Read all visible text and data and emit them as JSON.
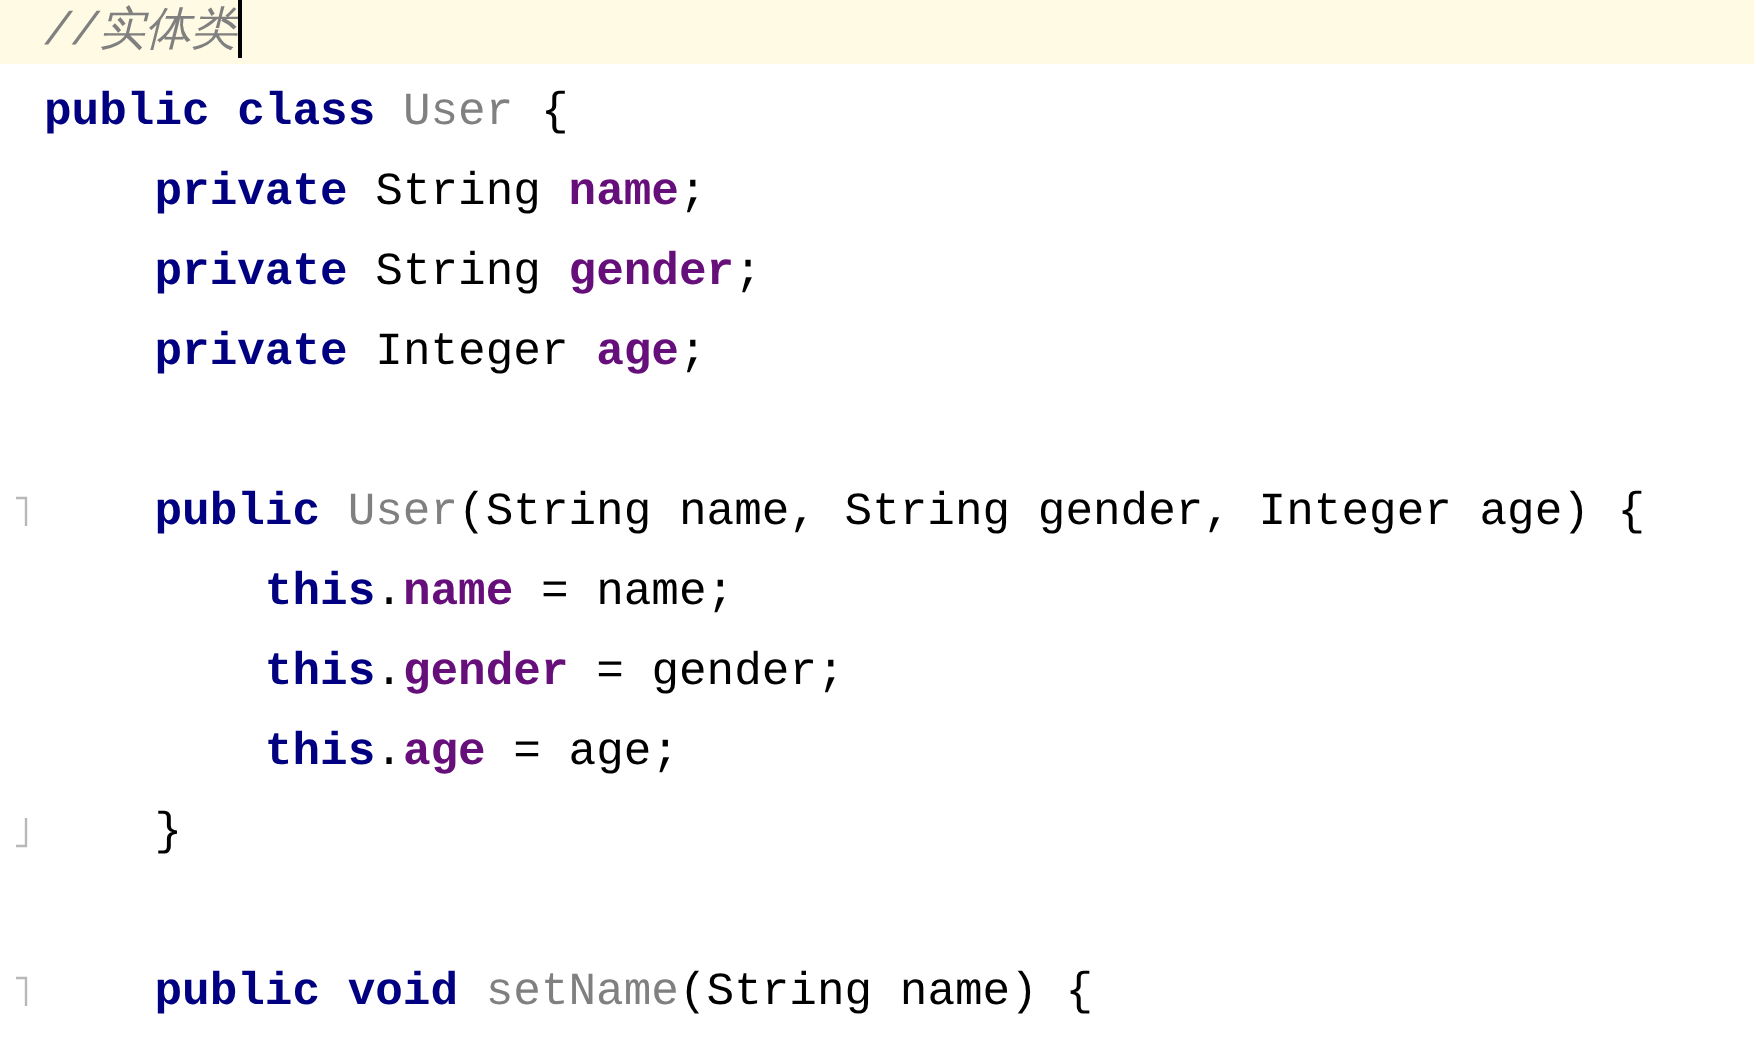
{
  "editor": {
    "lines": [
      {
        "current": true,
        "fold_start": false,
        "fold_end": false,
        "tokens": [
          {
            "kind": "comment",
            "text": "//实体类"
          }
        ]
      },
      {
        "current": false,
        "fold_start": false,
        "fold_end": false,
        "tokens": [
          {
            "kind": "keyword",
            "text": "public class "
          },
          {
            "kind": "unused",
            "text": "User"
          },
          {
            "kind": "plain",
            "text": " {"
          }
        ]
      },
      {
        "current": false,
        "fold_start": false,
        "fold_end": false,
        "tokens": [
          {
            "kind": "keyword",
            "text": "    private "
          },
          {
            "kind": "plain",
            "text": "String "
          },
          {
            "kind": "field",
            "text": "name"
          },
          {
            "kind": "plain",
            "text": ";"
          }
        ]
      },
      {
        "current": false,
        "fold_start": false,
        "fold_end": false,
        "tokens": [
          {
            "kind": "keyword",
            "text": "    private "
          },
          {
            "kind": "plain",
            "text": "String "
          },
          {
            "kind": "field",
            "text": "gender"
          },
          {
            "kind": "plain",
            "text": ";"
          }
        ]
      },
      {
        "current": false,
        "fold_start": false,
        "fold_end": false,
        "tokens": [
          {
            "kind": "keyword",
            "text": "    private "
          },
          {
            "kind": "plain",
            "text": "Integer "
          },
          {
            "kind": "field",
            "text": "age"
          },
          {
            "kind": "plain",
            "text": ";"
          }
        ]
      },
      {
        "current": false,
        "fold_start": false,
        "fold_end": false
      },
      {
        "current": false,
        "fold_start": true,
        "fold_end": false,
        "tokens": [
          {
            "kind": "keyword",
            "text": "    public "
          },
          {
            "kind": "unused",
            "text": "User"
          },
          {
            "kind": "plain",
            "text": "(String name, String gender, Integer age) {"
          }
        ]
      },
      {
        "current": false,
        "fold_start": false,
        "fold_end": false,
        "tokens": [
          {
            "kind": "keyword",
            "text": "        this"
          },
          {
            "kind": "plain",
            "text": "."
          },
          {
            "kind": "field",
            "text": "name"
          },
          {
            "kind": "plain",
            "text": " = name;"
          }
        ]
      },
      {
        "current": false,
        "fold_start": false,
        "fold_end": false,
        "tokens": [
          {
            "kind": "keyword",
            "text": "        this"
          },
          {
            "kind": "plain",
            "text": "."
          },
          {
            "kind": "field",
            "text": "gender"
          },
          {
            "kind": "plain",
            "text": " = gender;"
          }
        ]
      },
      {
        "current": false,
        "fold_start": false,
        "fold_end": false,
        "tokens": [
          {
            "kind": "keyword",
            "text": "        this"
          },
          {
            "kind": "plain",
            "text": "."
          },
          {
            "kind": "field",
            "text": "age"
          },
          {
            "kind": "plain",
            "text": " = age;"
          }
        ]
      },
      {
        "current": false,
        "fold_start": false,
        "fold_end": true,
        "tokens": [
          {
            "kind": "plain",
            "text": "    }"
          }
        ]
      },
      {
        "current": false,
        "fold_start": false,
        "fold_end": false
      },
      {
        "current": false,
        "fold_start": true,
        "fold_end": false,
        "tokens": [
          {
            "kind": "keyword",
            "text": "    public void "
          },
          {
            "kind": "unused",
            "text": "setName"
          },
          {
            "kind": "plain",
            "text": "(String name) {"
          }
        ]
      }
    ]
  }
}
